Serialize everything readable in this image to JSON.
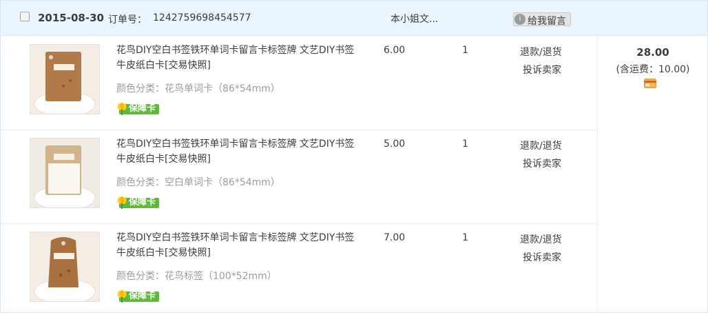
{
  "order": {
    "date": "2015-08-30",
    "order_no_label": "订单号：",
    "order_no": "1242759698454577",
    "shop_name": "本小姐文...",
    "message_button": "给我留言",
    "message_icon": "info-circle-icon",
    "total_price": "28.00",
    "shipping_text": "(含运费：10.00)",
    "payment_icon": "card-icon"
  },
  "items": [
    {
      "title": "花鸟DIY空白书签铁环单词卡留言卡标签牌 文艺DIY书签 牛皮纸白卡[交易快照]",
      "variant": "颜色分类：花鸟单词卡（86*54mm）",
      "badge": "保障卡",
      "price": "6.00",
      "qty": "1",
      "action_refund": "退款/退货",
      "action_complain": "投诉卖家"
    },
    {
      "title": "花鸟DIY空白书签铁环单词卡留言卡标签牌 文艺DIY书签 牛皮纸白卡[交易快照]",
      "variant": "颜色分类：空白单词卡（86*54mm）",
      "badge": "保障卡",
      "price": "5.00",
      "qty": "1",
      "action_refund": "退款/退货",
      "action_complain": "投诉卖家"
    },
    {
      "title": "花鸟DIY空白书签铁环单词卡留言卡标签牌 文艺DIY书签 牛皮纸白卡[交易快照]",
      "variant": "颜色分类：花鸟标签（100*52mm）",
      "badge": "保障卡",
      "price": "7.00",
      "qty": "1",
      "action_refund": "退款/退货",
      "action_complain": "投诉卖家"
    }
  ],
  "colors": {
    "header_bg": "#eaf5fd",
    "border": "#d7e6f2",
    "badge_green": "#5fb93a",
    "muted_text": "#9c9c9c"
  }
}
